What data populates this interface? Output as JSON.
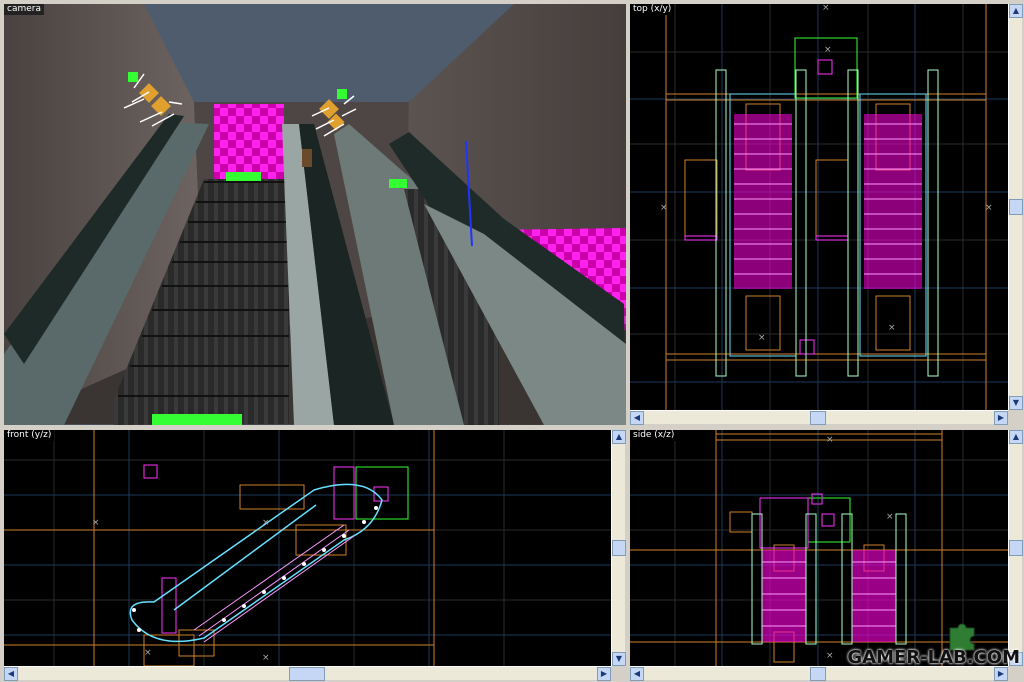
{
  "viewports": {
    "camera": {
      "label": "camera"
    },
    "top": {
      "label": "top (x/y)"
    },
    "front": {
      "label": "front (y/z)"
    },
    "side": {
      "label": "side (x/z)"
    }
  },
  "icons": {
    "scroll_left": "arrow-left-icon",
    "scroll_right": "arrow-right-icon",
    "scroll_up": "arrow-up-icon",
    "scroll_down": "arrow-down-icon",
    "watermark_logo": "puzzle-piece-icon"
  },
  "colors": {
    "grid_major": "#1a3a5a",
    "grid_minor": "#2a2a2a",
    "brush_orange": "#d0802a",
    "brush_magenta": "#ff33ff",
    "brush_cyan": "#66e0ff",
    "brush_green": "#33ff33",
    "texture_pink": "#ff00dd",
    "scrollbar": "#c5d7f5"
  },
  "watermark": {
    "text": "GAMER-LAB.COM"
  }
}
